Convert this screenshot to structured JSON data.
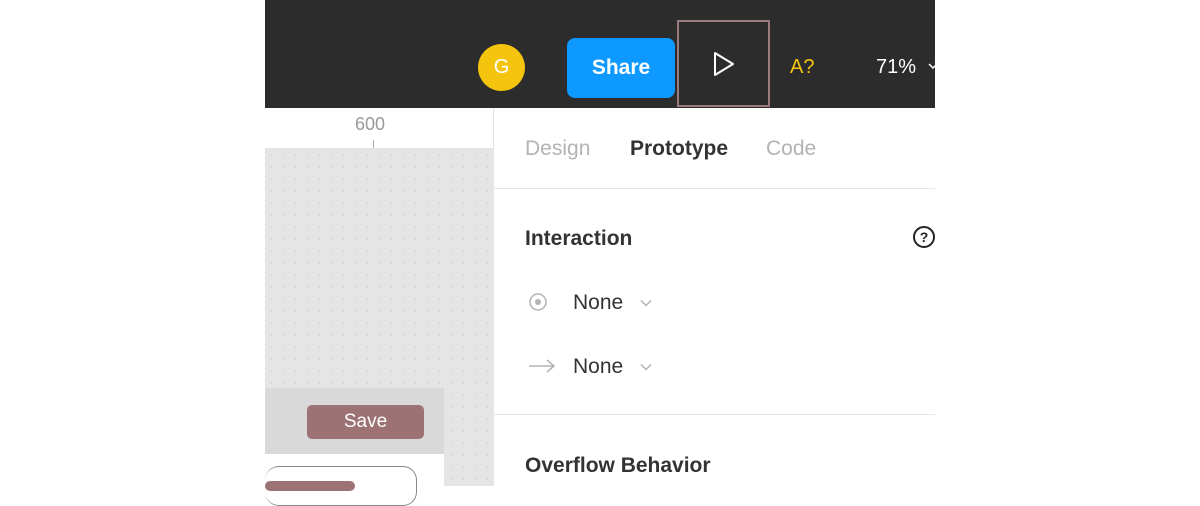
{
  "toolbar": {
    "avatar_initial": "G",
    "share_label": "Share",
    "assist_label": "A?",
    "zoom_value": "71%"
  },
  "ruler": {
    "label": "600"
  },
  "canvas": {
    "save_label": "Save"
  },
  "panel": {
    "tabs": [
      {
        "label": "Design",
        "active": false
      },
      {
        "label": "Prototype",
        "active": true
      },
      {
        "label": "Code",
        "active": false
      }
    ],
    "interaction": {
      "title": "Interaction",
      "trigger_value": "None",
      "action_value": "None"
    },
    "overflow": {
      "title": "Overflow Behavior"
    }
  },
  "colors": {
    "toolbar_bg": "#2c2c2c",
    "share_blue": "#0d99ff",
    "avatar_yellow": "#f5c40f",
    "save_rose": "#9c7274"
  },
  "icons": [
    "play-icon",
    "chevron-down-icon",
    "help-icon",
    "trigger-target-icon",
    "arrow-right-icon"
  ]
}
